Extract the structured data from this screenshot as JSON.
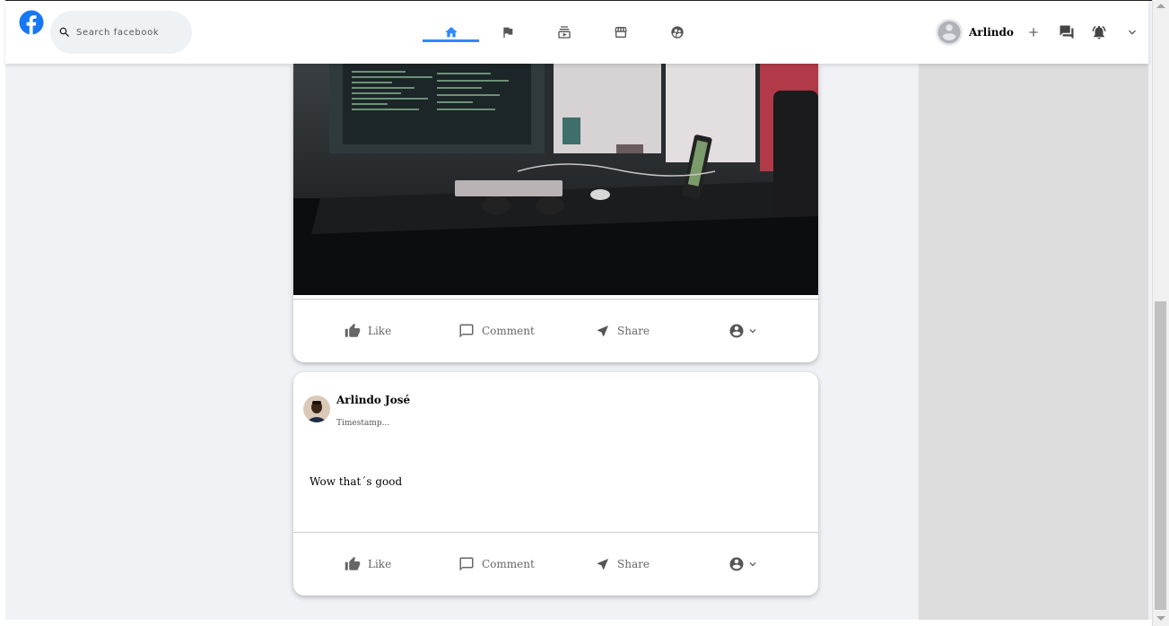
{
  "header": {
    "search_placeholder": "Search facebook",
    "user_name": "Arlindo",
    "nav": [
      "home-icon",
      "flag-icon",
      "subscriptions-icon",
      "storefront-icon",
      "supervised-user-icon"
    ]
  },
  "colors": {
    "brand": "#1877f2",
    "nav_active": "#2e89ff",
    "background": "#f0f2f5",
    "icon_gray": "#666666"
  },
  "posts": [
    {
      "image": "desk-monitors-photo",
      "actions": {
        "like": "Like",
        "comment": "Comment",
        "share": "Share"
      }
    },
    {
      "author": "Arlindo José",
      "timestamp": "Timestamp...",
      "text": "Wow that´s good",
      "actions": {
        "like": "Like",
        "comment": "Comment",
        "share": "Share"
      }
    }
  ]
}
